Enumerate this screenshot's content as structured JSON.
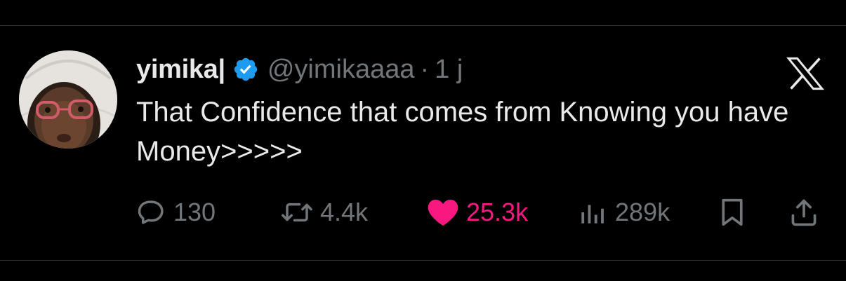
{
  "author": {
    "display_name": "yimika|",
    "handle": "@yimikaaaa",
    "separator": "·",
    "time": "1 j",
    "verified": true
  },
  "tweet": {
    "text": "That Confidence that comes from Knowing you have Money>>>>>"
  },
  "actions": {
    "reply_count": "130",
    "retweet_count": "4.4k",
    "like_count": "25.3k",
    "view_count": "289k"
  },
  "icons": {
    "verified": "verified-badge-icon",
    "platform": "x-logo-icon",
    "reply": "reply-icon",
    "retweet": "retweet-icon",
    "like": "heart-icon",
    "views": "views-icon",
    "bookmark": "bookmark-icon",
    "share": "share-icon"
  },
  "colors": {
    "background": "#000000",
    "text_primary": "#e7e9ea",
    "text_secondary": "#71767b",
    "verified_blue": "#1d9bf0",
    "like_pink": "#f91880",
    "divider": "#2f3336"
  }
}
